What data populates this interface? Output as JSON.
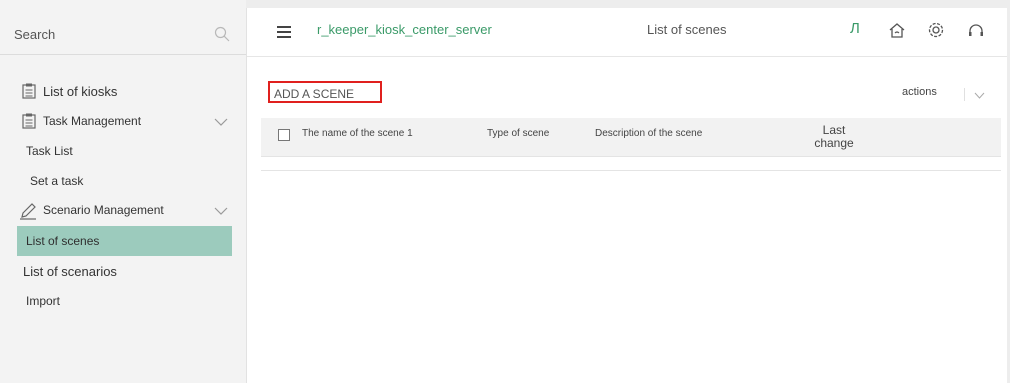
{
  "sidebar": {
    "search_label": "Search",
    "items": [
      {
        "label": "List of kiosks"
      },
      {
        "label": "Task Management"
      },
      {
        "label": "Task List"
      },
      {
        "label": "Set a task"
      },
      {
        "label": "Scenario Management"
      },
      {
        "label": "List of scenes",
        "active": true
      },
      {
        "label": "List of scenarios"
      },
      {
        "label": "Import"
      }
    ]
  },
  "header": {
    "app_title": "r_keeper_kiosk_center_server",
    "page_title": "List of scenes",
    "lang_label": "Л"
  },
  "toolbar": {
    "add_label": "ADD A SCENE",
    "actions_label": "actions"
  },
  "table": {
    "columns": [
      "The name of the scene 1",
      "Type of scene",
      "Description of the scene",
      "Last change"
    ]
  },
  "colors": {
    "accent": "#3a9a68",
    "active_bg": "#9ccbbd",
    "highlight_border": "#e0201e"
  }
}
